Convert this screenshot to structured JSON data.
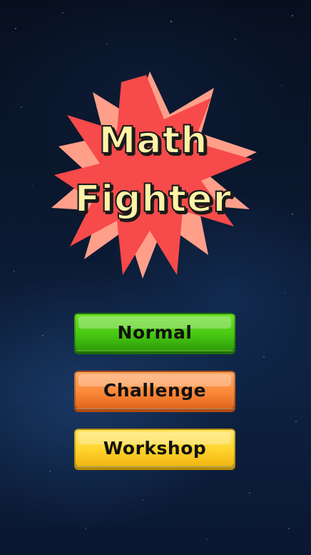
{
  "title": {
    "line1": "Math",
    "line2": "Fighter"
  },
  "menu": {
    "normal_label": "Normal",
    "challenge_label": "Challenge",
    "workshop_label": "Workshop"
  },
  "colors": {
    "background": "#0b1a33",
    "burst_front": "#f74a4a",
    "burst_back": "#ff9f8a",
    "title_fill": "#fff3a8",
    "normal_button": "#48c912",
    "challenge_button": "#fb8a3a",
    "workshop_button": "#ffd42c"
  }
}
